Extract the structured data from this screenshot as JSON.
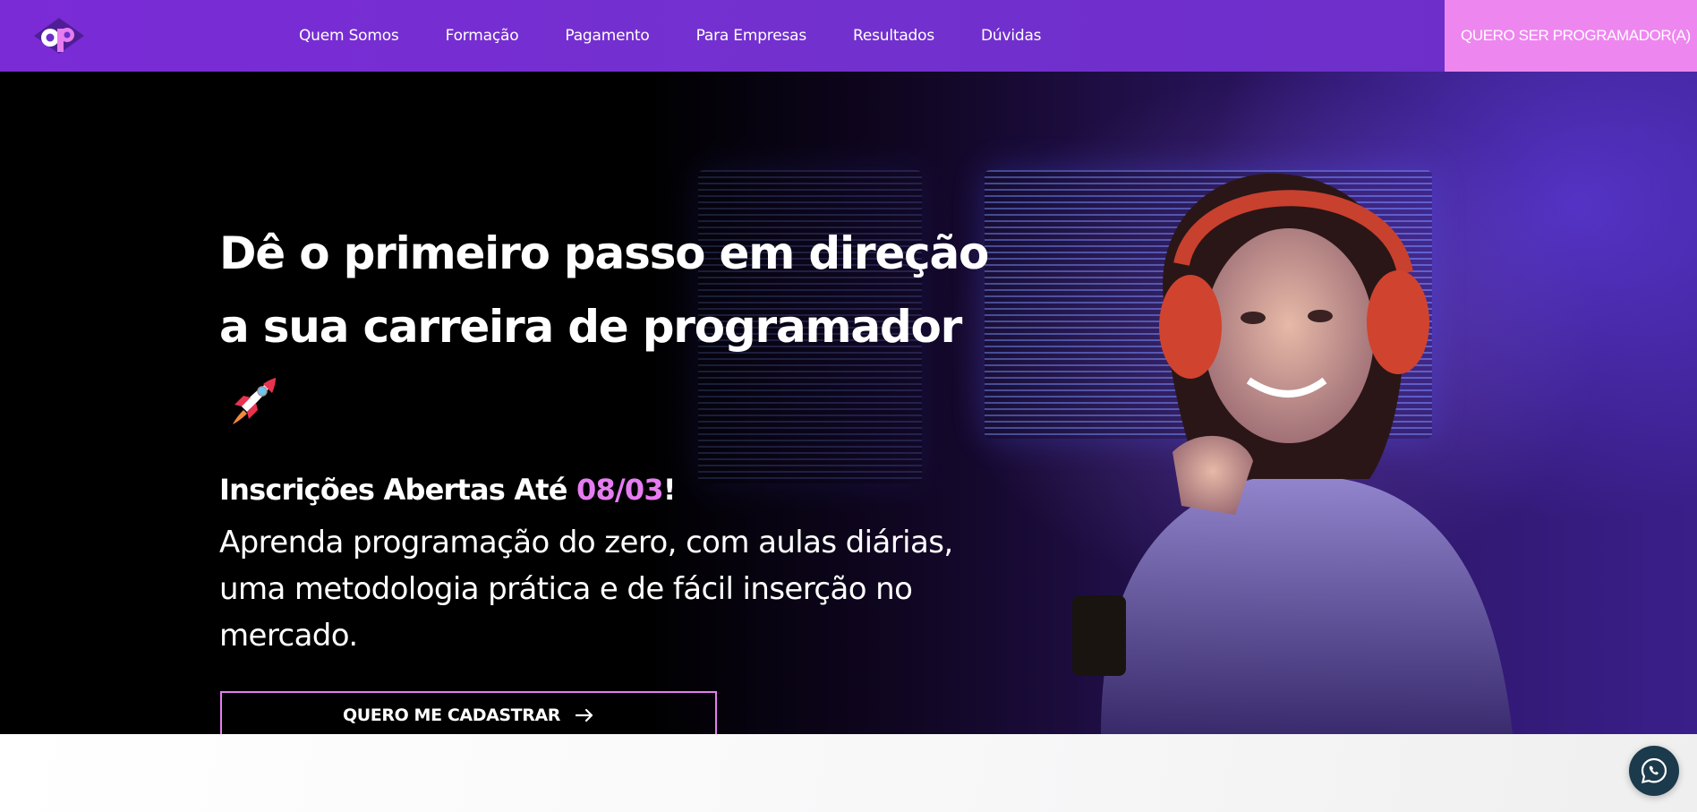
{
  "nav": {
    "links": [
      "Quem Somos",
      "Formação",
      "Pagamento",
      "Para Empresas",
      "Resultados",
      "Dúvidas"
    ],
    "cta_label": "QUERO SER PROGRAMADOR(A)"
  },
  "hero": {
    "title_line1": "Dê o primeiro passo em direção",
    "title_line2": "a sua carreira de programador",
    "subhead_prefix": "Inscrições Abertas Até ",
    "subhead_date": "08/03",
    "subhead_suffix": "!",
    "desc_line1": "Aprenda programação do zero, com aulas diárias,",
    "desc_line2": "uma metodologia prática e de fácil inserção no",
    "desc_line3": "mercado.",
    "button_label": "QUERO ME CADASTRAR"
  },
  "colors": {
    "nav_bg": "#7330cf",
    "cta_bg": "#ee86f0",
    "accent": "#e77cf2",
    "hero_bg": "#000000",
    "whatsapp_bg": "#1b3a4b"
  },
  "icons": {
    "logo": "ap-logo",
    "rocket": "rocket-icon",
    "arrow": "arrow-right-icon",
    "whatsapp": "whatsapp-icon"
  }
}
